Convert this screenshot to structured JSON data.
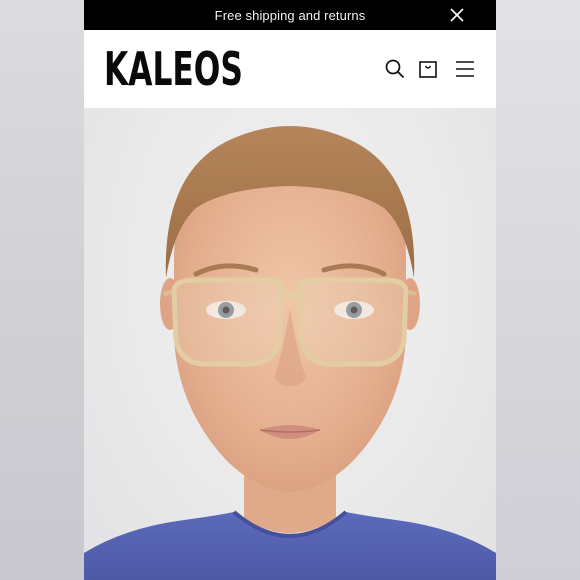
{
  "promo": {
    "text": "Free shipping and returns"
  },
  "brand": {
    "logo_text": "KALEOS"
  },
  "header": {
    "icons": [
      "search-icon",
      "shopping-bag-icon",
      "hamburger-menu-icon"
    ]
  },
  "promo_close_icon": "close-icon",
  "colors": {
    "promo_bg": "#000000",
    "header_bg": "#ffffff",
    "logo": "#0a0a0a",
    "shirt": "#5a68b8",
    "frames": "#e6d2a8"
  }
}
